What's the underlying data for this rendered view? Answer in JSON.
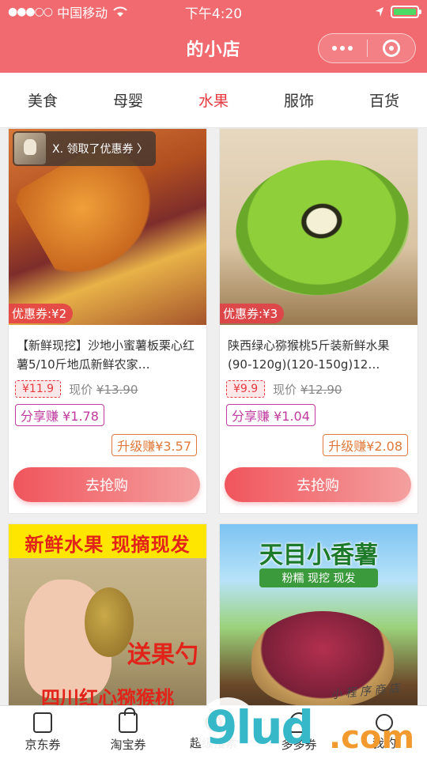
{
  "status_bar": {
    "carrier": "中国移动",
    "time": "下午4:20"
  },
  "header": {
    "title": "的小店"
  },
  "categories": [
    {
      "label": "美食"
    },
    {
      "label": "母婴"
    },
    {
      "label": "水果",
      "active": true
    },
    {
      "label": "服饰"
    },
    {
      "label": "百货"
    }
  ],
  "claim_popup": {
    "text": "X. 领取了优惠券 〉"
  },
  "products": [
    {
      "coupon": "优惠券:¥2",
      "name": "【新鲜现挖】沙地小蜜薯板栗心红薯5/10斤地瓜新鲜农家…",
      "price": "¥11.9",
      "orig_label": "现价",
      "orig_price": "¥13.90",
      "share": "分享赚 ¥1.78",
      "upgrade": "升级赚¥3.57",
      "buy": "去抢购"
    },
    {
      "coupon": "优惠券:¥3",
      "name": "陕西绿心猕猴桃5斤装新鲜水果(90-120g)(120-150g)12…",
      "price": "¥9.9",
      "orig_label": "现价",
      "orig_price": "¥12.90",
      "share": "分享赚 ¥1.04",
      "upgrade": "升级赚¥2.08",
      "buy": "去抢购"
    },
    {
      "image_text_top": "新鲜水果 现摘现发",
      "image_text_mid": "送果勺",
      "image_text_bottom": "四川红心猕猴桃"
    },
    {
      "image_text_top": "天目小香薯",
      "image_text_sub": "粉糯 现挖 现发"
    }
  ],
  "tabbar": [
    {
      "label": "京东券",
      "icon": "jd-coupon-icon"
    },
    {
      "label": "淘宝券",
      "icon": "taobao-bag-icon"
    },
    {
      "label": "超级搜索",
      "icon": "search-icon"
    },
    {
      "label": "多多券",
      "icon": "pdd-coupon-icon"
    },
    {
      "label": "我的",
      "icon": "user-icon"
    }
  ],
  "watermark": {
    "main": "9lud",
    "tld": ".com",
    "script": "小 程 序 商 店"
  },
  "colors": {
    "brand": "#f06a6f",
    "active_tab": "#e5383f",
    "share": "#c03aa0",
    "upgrade": "#e07a3a"
  }
}
